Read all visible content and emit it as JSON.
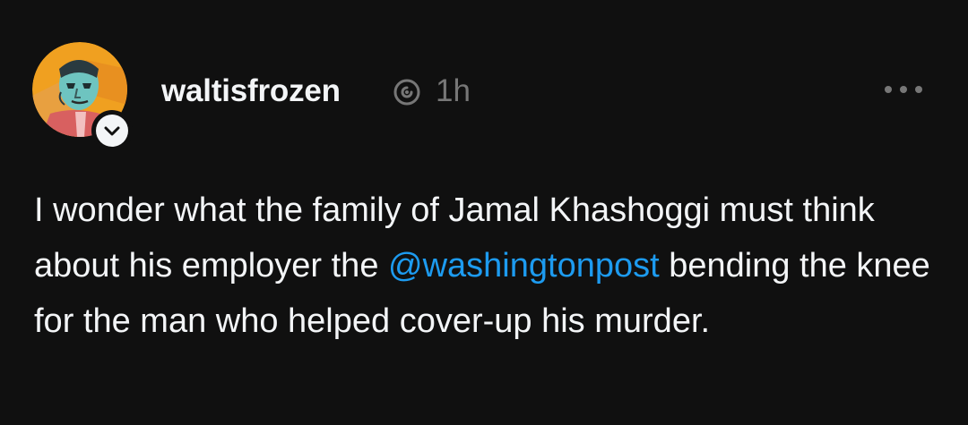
{
  "post": {
    "author": {
      "username": "waltisfrozen",
      "avatar_icon": "portrait-avatar",
      "badge_icon": "follow-chevron-icon"
    },
    "meta": {
      "platform_icon": "threads-icon",
      "timestamp": "1h"
    },
    "menu_icon": "more-options-icon",
    "text": {
      "part1": "I wonder what the family of Jamal Khashoggi must think about his employer the ",
      "mention": "@washingtonpost",
      "part2": " bending the knee for the man who helped cover-up his murder."
    }
  },
  "colors": {
    "background": "#101010",
    "text": "#f3f5f7",
    "muted": "#777777",
    "mention": "#1d9bf0"
  }
}
